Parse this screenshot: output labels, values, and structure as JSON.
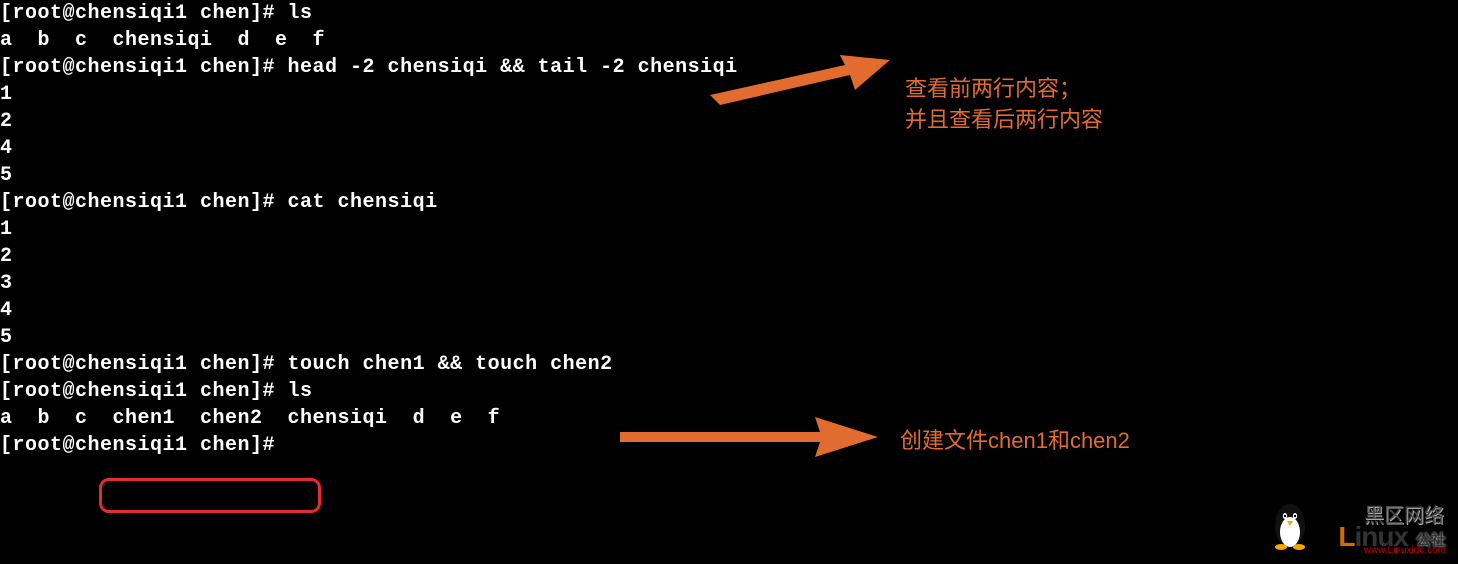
{
  "terminal": {
    "lines": [
      "[root@chensiqi1 chen]# ls",
      "a  b  c  chensiqi  d  e  f",
      "[root@chensiqi1 chen]# head -2 chensiqi && tail -2 chensiqi",
      "1",
      "2",
      "4",
      "5",
      "[root@chensiqi1 chen]# cat chensiqi",
      "1",
      "2",
      "3",
      "4",
      "5",
      "[root@chensiqi1 chen]# touch chen1 && touch chen2",
      "[root@chensiqi1 chen]# ls",
      "a  b  c  chen1  chen2  chensiqi  d  e  f",
      "[root@chensiqi1 chen]# "
    ]
  },
  "annotations": {
    "a1_line1": "查看前两行内容；",
    "a1_line2": "并且查看后两行内容",
    "a2": "创建文件chen1和chen2"
  },
  "watermark": {
    "top_cn": "黑区网络",
    "brand_colored": "L",
    "brand_rest": "inux",
    "cn_suffix": "公社",
    "url": "www.Linuxidc.com"
  },
  "colors": {
    "annotation": "#e26b2f",
    "redbox": "#e42c2c"
  }
}
